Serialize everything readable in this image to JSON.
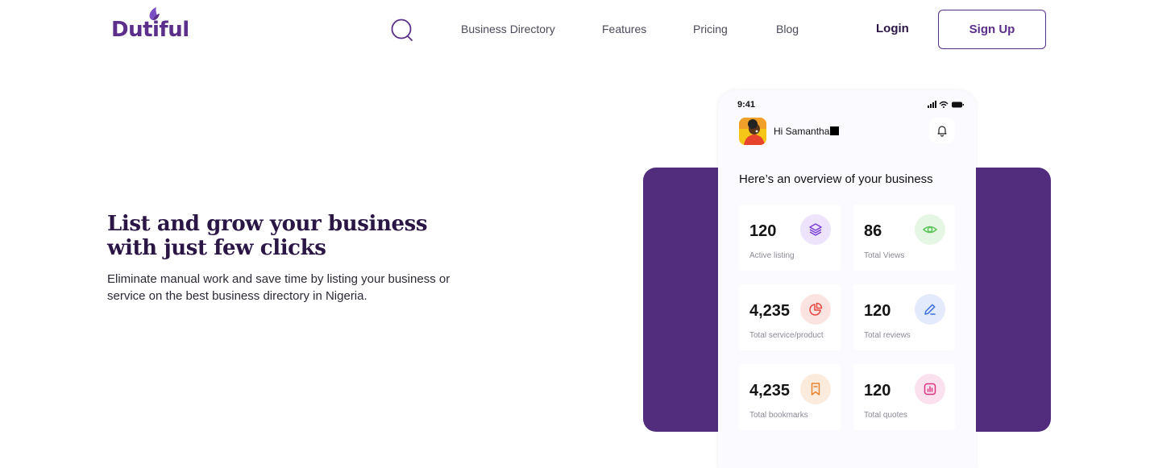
{
  "brand": {
    "name": "Dutiful",
    "color": "#5b2f8a"
  },
  "nav": {
    "search_icon": "search-icon",
    "links": [
      "Business Directory",
      "Features",
      "Pricing",
      "Blog"
    ],
    "login": "Login",
    "signup": "Sign Up"
  },
  "hero": {
    "title": "List and grow your business with just few clicks",
    "subtitle": "Eliminate manual work and save time by listing your business or service on the best business directory in Nigeria."
  },
  "phone": {
    "time": "9:41",
    "greeting": "Hi Samantha",
    "overview_title": "Here’s an overview of your business",
    "stats": [
      {
        "value": "120",
        "label": "Active listing",
        "icon": "layers-icon",
        "color": "#7b3fd6",
        "bg": "#ede4fb"
      },
      {
        "value": "86",
        "label": "Total Views",
        "icon": "eye-icon",
        "color": "#5cc45a",
        "bg": "#e6f6e4"
      },
      {
        "value": "4,235",
        "label": "Total service/product",
        "icon": "pie-chart-icon",
        "color": "#e5473f",
        "bg": "#fbe3e1"
      },
      {
        "value": "120",
        "label": "Total reviews",
        "icon": "edit-icon",
        "color": "#3b6fe0",
        "bg": "#e2eafb"
      },
      {
        "value": "4,235",
        "label": "Total bookmarks",
        "icon": "bookmark-icon",
        "color": "#e8832e",
        "bg": "#fbebdc"
      },
      {
        "value": "120",
        "label": "Total quotes",
        "icon": "chart-icon",
        "color": "#d9357f",
        "bg": "#fbe1ee"
      }
    ]
  },
  "colors": {
    "purple_card": "#522d7e",
    "heading": "#2b1745"
  }
}
